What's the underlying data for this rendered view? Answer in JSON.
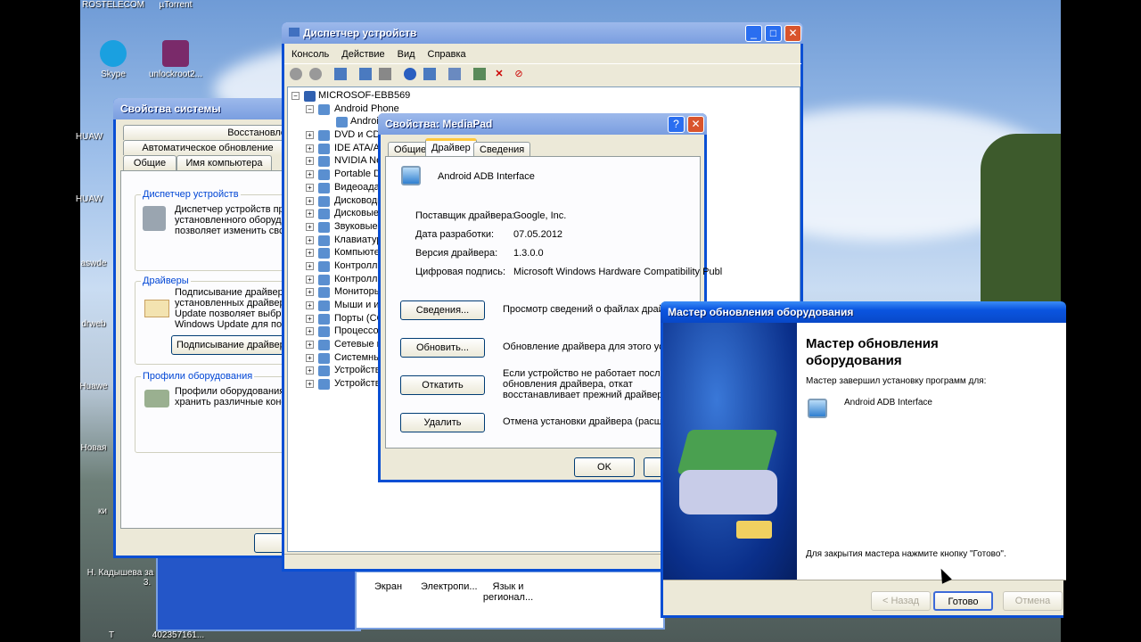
{
  "desktop": {
    "icons": [
      "ROSTELECOM",
      "µTorrent",
      "Skype",
      "unlockroot2...",
      "HUAW",
      "HUAW",
      "aswde",
      "drweb",
      "Huawe",
      "Новая",
      "ки",
      "Н. Кадышева за",
      "3.",
      "Т",
      "402357161..."
    ]
  },
  "system_props": {
    "title": "Свойства системы",
    "tabs_row1": [
      "Восстановле"
    ],
    "tabs_row2": [
      "Автоматическое обновление"
    ],
    "tabs_row3": [
      "Общие",
      "Имя компьютера"
    ],
    "groups": [
      {
        "label": "Диспетчер устройств",
        "text": "Диспетчер устройств пр установленного оборудо позволяет изменить свс"
      },
      {
        "label": "Драйверы",
        "text": "Подписывание драйверо установленных драйверо Update позволяет выбра к Windows Update для по",
        "button": "Подписывание драйверо"
      },
      {
        "label": "Профили оборудования",
        "text": "Профили оборудования хранить различные конф"
      }
    ]
  },
  "device_manager": {
    "title": "Диспетчер устройств",
    "menu": [
      "Консоль",
      "Действие",
      "Вид",
      "Справка"
    ],
    "root": "MICROSOF-EBB569",
    "items": [
      {
        "label": "Android Phone",
        "expanded": true
      },
      {
        "label": "Androic",
        "child": true
      },
      {
        "label": "DVD и CD-R"
      },
      {
        "label": "IDE ATA/AT"
      },
      {
        "label": "NVIDIA Net"
      },
      {
        "label": "Portable De"
      },
      {
        "label": "Видеоадаг"
      },
      {
        "label": "Дисководы"
      },
      {
        "label": "Дисковые"
      },
      {
        "label": "Звуковые,"
      },
      {
        "label": "Клавиатур"
      },
      {
        "label": "Компьютер"
      },
      {
        "label": "Контролле"
      },
      {
        "label": "Контролле"
      },
      {
        "label": "Мониторы"
      },
      {
        "label": "Мыши и ин"
      },
      {
        "label": "Порты (СС"
      },
      {
        "label": "Процессор"
      },
      {
        "label": "Сетевые п"
      },
      {
        "label": "Системные"
      },
      {
        "label": "Устройств"
      },
      {
        "label": "Устройств"
      }
    ]
  },
  "control_panel": {
    "items": [
      "Экран",
      "Электропи...",
      "Язык и регионал..."
    ]
  },
  "mediapad": {
    "title": "Свойства: MediaPad",
    "tabs": [
      "Общие",
      "Драйвер",
      "Сведения"
    ],
    "device": "Android ADB Interface",
    "props": [
      {
        "k": "Поставщик драйвера:",
        "v": "Google, Inc."
      },
      {
        "k": "Дата разработки:",
        "v": "07.05.2012"
      },
      {
        "k": "Версия драйвера:",
        "v": "1.3.0.0"
      },
      {
        "k": "Цифровая подпись:",
        "v": "Microsoft Windows Hardware Compatibility Publ"
      }
    ],
    "actions": [
      {
        "btn": "Сведения...",
        "desc": "Просмотр сведений о файлах драйвера"
      },
      {
        "btn": "Обновить...",
        "desc": "Обновление драйвера для этого устр"
      },
      {
        "btn": "Откатить",
        "desc": "Если устройство не работает после обновления драйвера, откат восстанавливает прежний драйвер."
      },
      {
        "btn": "Удалить",
        "desc": "Отмена установки драйвера (расшире"
      }
    ],
    "ok": "OK",
    "cancel": "О"
  },
  "wizard": {
    "title": "Мастер обновления оборудования",
    "heading": "Мастер обновления оборудования",
    "subtitle": "Мастер завершил установку программ для:",
    "device": "Android ADB Interface",
    "hint": "Для закрытия мастера нажмите кнопку \"Готово\".",
    "back": "< Назад",
    "finish": "Готово",
    "cancel": "Отмена"
  }
}
